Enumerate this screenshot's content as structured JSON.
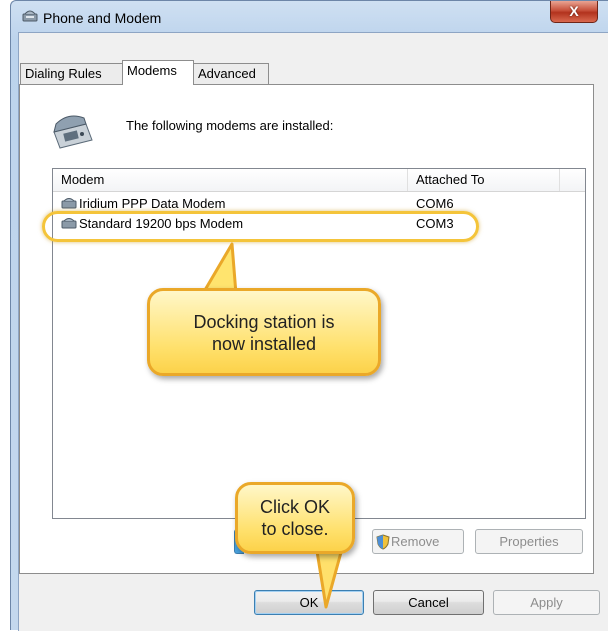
{
  "window": {
    "title": "Phone and Modem",
    "close_glyph": "X"
  },
  "tabs": [
    {
      "label": "Dialing Rules",
      "active": false
    },
    {
      "label": "Modems",
      "active": true
    },
    {
      "label": "Advanced",
      "active": false
    }
  ],
  "panel": {
    "header_text": "The following modems are installed:"
  },
  "list": {
    "columns": [
      "Modem",
      "Attached To"
    ],
    "rows": [
      {
        "modem": "Iridium PPP Data Modem",
        "port": "COM6"
      },
      {
        "modem": "Standard 19200 bps Modem",
        "port": "COM3"
      }
    ]
  },
  "panel_buttons": {
    "remove": "Remove",
    "properties": "Properties"
  },
  "dialog_buttons": {
    "ok": "OK",
    "cancel": "Cancel",
    "apply": "Apply"
  },
  "callouts": {
    "installed": {
      "line1": "Docking station is",
      "line2": "now installed"
    },
    "close": {
      "line1": "Click OK",
      "line2": "to close."
    }
  },
  "colors": {
    "highlight": "#f4c43a",
    "callout_border": "#eaa829",
    "callout_fill": "#ffe06b"
  },
  "icons": {
    "title": "modem-icon",
    "header": "telephone-icon",
    "row": "modem-icon",
    "remove": "shield-icon"
  }
}
